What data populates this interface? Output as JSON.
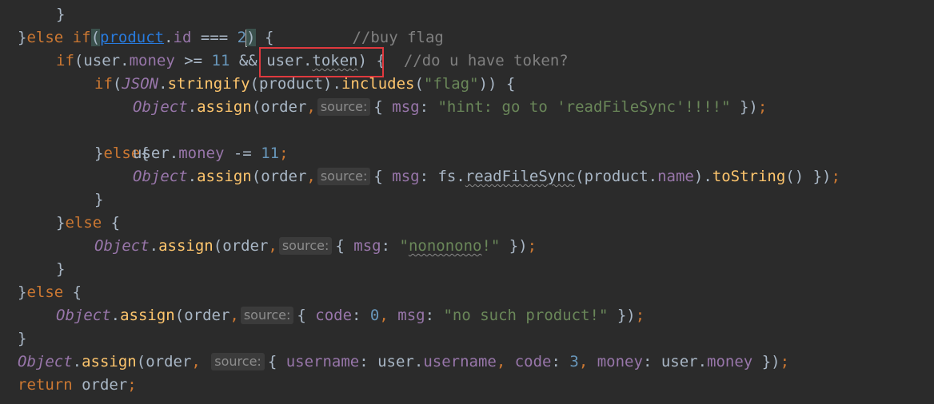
{
  "lines": {
    "l0": {
      "brace": "}"
    },
    "l1": {
      "b1": "}",
      "kw1": "else",
      "kw2": "if",
      "p1": "(",
      "obj": "product",
      "dot": ".",
      "prop": "id",
      "op": " === ",
      "num": "2",
      "p2": ")",
      "b2": " {",
      "cmt": "//buy flag"
    },
    "l2": {
      "kw": "if",
      "p1": "(",
      "u1": "user",
      "d1": ".",
      "money": "money",
      "op1": " >= ",
      "n11": "11",
      "op2": " && ",
      "u2": "user",
      "d2": ".",
      "token": "token",
      "p2": ")",
      "b": " {",
      "cmt": "//do u have token?"
    },
    "l3": {
      "kw": "if",
      "p1": "(",
      "json": "JSON",
      "d1": ".",
      "fn1": "stringify",
      "p2": "(",
      "prod": "product",
      "p3": ")",
      "d2": ".",
      "fn2": "includes",
      "p4": "(",
      "str": "\"flag\"",
      "p5": "))",
      "b": " {"
    },
    "l4": {
      "obj": "Object",
      "d": ".",
      "fn": "assign",
      "p1": "(",
      "arg": "order",
      "comma": ",",
      "hint": "source:",
      "b1": "{ ",
      "key": "msg",
      "colon": ": ",
      "str": "\"hint: go to 'readFileSync'!!!!\"",
      "b2": " })",
      "semi": ";"
    },
    "l5": {
      "b": "}",
      "kw": "else",
      "b2": "{"
    },
    "l6": {
      "user": "user",
      "d": ".",
      "money": "money",
      "op": " -= ",
      "num": "11",
      "semi": ";"
    },
    "l7": {
      "obj": "Object",
      "d": ".",
      "fn": "assign",
      "p1": "(",
      "arg": "order",
      "comma": ",",
      "hint": "source:",
      "b1": "{ ",
      "key": "msg",
      "colon": ": ",
      "fs": "fs",
      "d2": ".",
      "fn2": "readFileSync",
      "p2": "(",
      "prod": "product",
      "d3": ".",
      "name": "name",
      "p3": ")",
      "d4": ".",
      "fn3": "toString",
      "p4": "()",
      "b2": " })",
      "semi": ";"
    },
    "l8": {
      "b": "}"
    },
    "l9": {
      "b": "}",
      "kw": "else",
      "b2": " {"
    },
    "l10": {
      "obj": "Object",
      "d": ".",
      "fn": "assign",
      "p1": "(",
      "arg": "order",
      "comma": ",",
      "hint": "source:",
      "b1": "{ ",
      "key": "msg",
      "colon": ": ",
      "q1": "\"",
      "str": "nononono",
      "q2": "!\"",
      "b2": " })",
      "semi": ";"
    },
    "l11": {
      "b": "}"
    },
    "l12": {
      "b": "}",
      "kw": "else",
      "b2": " {"
    },
    "l13": {
      "obj": "Object",
      "d": ".",
      "fn": "assign",
      "p1": "(",
      "arg": "order",
      "comma": ",",
      "hint": "source:",
      "b1": "{ ",
      "key1": "code",
      "c1": ": ",
      "num": "0",
      "comma2": ", ",
      "key2": "msg",
      "c2": ": ",
      "str": "\"no such product!\"",
      "b2": " })",
      "semi": ";"
    },
    "l14": {
      "b": "}"
    },
    "l15": {
      "obj": "Object",
      "d": ".",
      "fn": "assign",
      "p1": "(",
      "arg": "order",
      "comma": ", ",
      "hint": "source:",
      "b1": "{ ",
      "key1": "username",
      "c1": ": ",
      "u": "user",
      "d2": ".",
      "uname": "username",
      "comma2": ", ",
      "key2": "code",
      "c2": ": ",
      "num": "3",
      "comma3": ", ",
      "key3": "money",
      "c3": ": ",
      "u2": "user",
      "d3": ".",
      "money": "money",
      "b2": " })",
      "semi": ";"
    },
    "l16": {
      "kw": "return",
      "var": " order",
      "semi": ";"
    }
  },
  "colors": {
    "background": "#2b2b2b",
    "keyword": "#cc7832",
    "number": "#6897bb",
    "property": "#9876aa",
    "function": "#ffc66d",
    "string": "#6a8759",
    "comment": "#808080",
    "highlight_box": "#e0393e"
  }
}
